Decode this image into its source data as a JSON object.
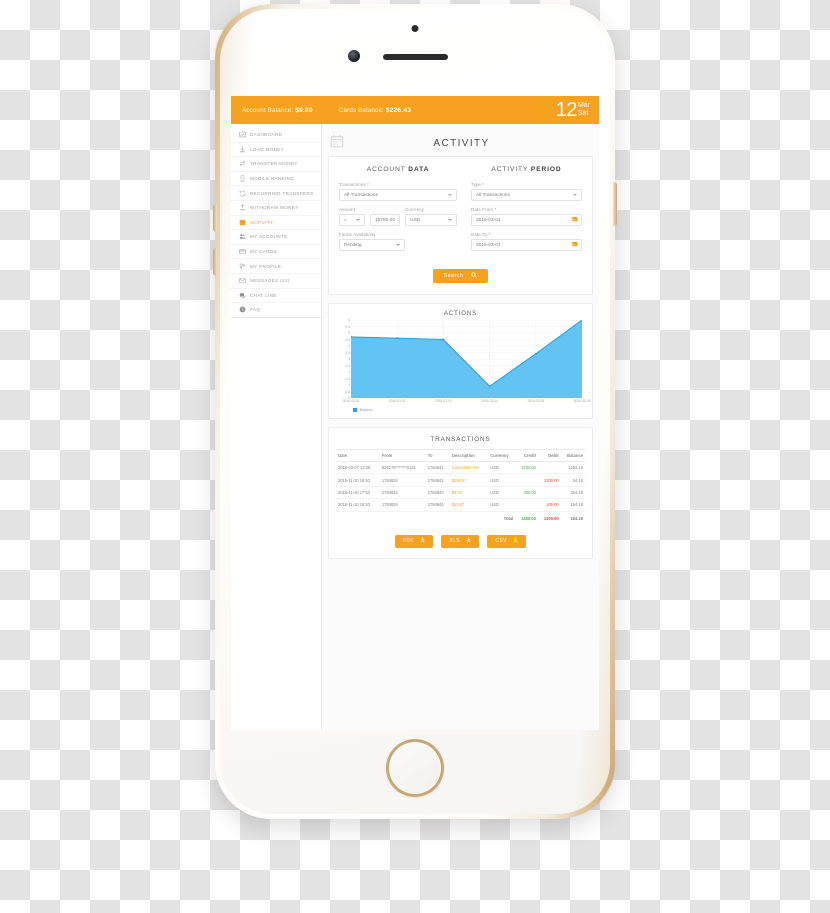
{
  "topbar": {
    "account_balance_label": "Account Balance:",
    "account_balance_value": "$0.00",
    "cards_balance_label": "Cards Balance:",
    "cards_balance_value": "$226.43",
    "date_day": "12",
    "date_month": "Mar",
    "date_weekday": "Sat"
  },
  "sidebar": {
    "items": [
      {
        "label": "DASHBOARD",
        "icon": "dashboard-icon",
        "active": false
      },
      {
        "label": "LOAD MONEY",
        "icon": "load-money-icon",
        "active": false
      },
      {
        "label": "TRANSFER MONEY",
        "icon": "transfer-money-icon",
        "active": false
      },
      {
        "label": "MOBILE BANKING",
        "icon": "mobile-banking-icon",
        "active": false
      },
      {
        "label": "RECURRING TRANSFERS",
        "icon": "recurring-transfers-icon",
        "active": false
      },
      {
        "label": "WITHDRAW MONEY",
        "icon": "withdraw-money-icon",
        "active": false
      },
      {
        "label": "ACTIVITY",
        "icon": "activity-calendar-icon",
        "active": true
      },
      {
        "label": "MY ACCOUNTS",
        "icon": "my-accounts-icon",
        "active": false
      },
      {
        "label": "MY CARDS",
        "icon": "my-cards-icon",
        "active": false
      },
      {
        "label": "MY PROFILE",
        "icon": "my-profile-icon",
        "active": false
      },
      {
        "label": "MESSAGES (22)",
        "icon": "messages-icon",
        "active": false
      },
      {
        "label": "CHAT LINE",
        "icon": "chat-line-icon",
        "active": false
      },
      {
        "label": "FAQ",
        "icon": "faq-icon",
        "active": false
      }
    ]
  },
  "page": {
    "title": "ACTIVITY",
    "header_icon": "calendar-icon"
  },
  "search_panel": {
    "account_data_title_light": "ACCOUNT ",
    "account_data_title_bold": "DATA",
    "activity_period_title_light": "ACTIVITY ",
    "activity_period_title_bold": "PERIOD",
    "transactions_label": "Transactions",
    "transactions_value": "All Transactions",
    "type_label": "Type",
    "type_value": "All Transactions",
    "amount_label": "Amount",
    "amount_operator": "=",
    "amount_value": "15780.00",
    "currency_label": "Currency",
    "currency_value": "USD",
    "date_from_label": "Date From",
    "date_from_value": "2016-03-01",
    "date_to_label": "Date To",
    "date_to_value": "2015-03-01",
    "funds_availability_label": "Funds Availability",
    "funds_availability_value": "Pending",
    "required_marker": "*",
    "search_button": "Search",
    "search_icon": "magnifier-icon"
  },
  "chart_data": {
    "type": "area",
    "title": "ACTIONS",
    "xlabel": "",
    "ylabel": "",
    "categories": [
      "2016-03-01",
      "2016-03-02",
      "2016-03-03",
      "2016-03-04",
      "2016-03-05",
      "2016-03-06"
    ],
    "series": [
      {
        "name": "Balance",
        "values": [
          4.7,
          4.6,
          4.5,
          0.9,
          3.4,
          6.0
        ],
        "color": "#5bc0f2"
      }
    ],
    "ylim": [
      0,
      6
    ],
    "yticks": [
      "0",
      "0.5",
      "1",
      "1.5",
      "2",
      "2.5",
      "3",
      "3.5",
      "4",
      "4.5",
      "5",
      "5.5",
      "6"
    ],
    "grid": true,
    "legend_position": "bottom-left",
    "legend": [
      "Balance"
    ]
  },
  "transactions": {
    "title": "TRANSACTIONS",
    "columns": [
      "Date",
      "From",
      "To",
      "Description",
      "Currency",
      "Credit",
      "Debit",
      "Balance"
    ],
    "rows": [
      {
        "date": "2016-03-07 12:26",
        "from": "526179*******0131",
        "to": "1784841",
        "description": "Consultant Fee",
        "currency": "USD",
        "credit": "1200.00",
        "debit": "",
        "balance": "1254.16"
      },
      {
        "date": "2015-11-10 16:53",
        "from": "1784834",
        "to": "1784842",
        "description": "$250.67",
        "currency": "USD",
        "credit": "",
        "debit": "1200.00",
        "balance": "54.16"
      },
      {
        "date": "2015-11-10 17:53",
        "from": "1784834",
        "to": "1784843",
        "description": "$4.00",
        "currency": "USD",
        "credit": "200.00",
        "debit": "",
        "balance": "254.16"
      },
      {
        "date": "2015-11-10 18:53",
        "from": "1784834",
        "to": "1784844",
        "description": "$23.67",
        "currency": "USD",
        "credit": "",
        "debit": "100.00",
        "balance": "154.16"
      }
    ],
    "total_label": "Total",
    "total_credit": "1400.00",
    "total_debit": "1300.00",
    "total_balance": "154.16"
  },
  "exports": {
    "buttons": [
      {
        "label": "PDF",
        "icon": "download-icon"
      },
      {
        "label": "XLS",
        "icon": "download-icon"
      },
      {
        "label": "CSV",
        "icon": "download-icon"
      }
    ]
  },
  "colors": {
    "accent": "#f5a21e",
    "chart_fill": "#5bc0f2",
    "chart_line": "#2f9fe0",
    "credit": "#46b04a",
    "debit": "#e0453b",
    "description": "#f0a334"
  }
}
